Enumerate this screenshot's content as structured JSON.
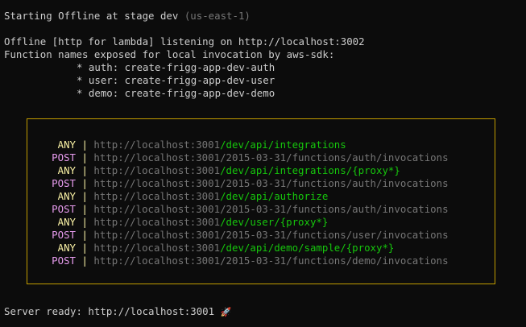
{
  "header": {
    "starting_text": "Starting Offline at stage dev",
    "region_text": "(us-east-1)"
  },
  "info": {
    "listening_line": "Offline [http for lambda] listening on http://localhost:3002",
    "functions_line": "Function names exposed for local invocation by aws-sdk:",
    "functions": [
      "* auth: create-frigg-app-dev-auth",
      "* user: create-frigg-app-dev-user",
      "* demo: create-frigg-app-dev-demo"
    ]
  },
  "routes": [
    {
      "method": "ANY",
      "host": "http://localhost:3001",
      "path": "/dev/api/integrations",
      "kind": "http"
    },
    {
      "method": "POST",
      "host": "http://localhost:3001",
      "path": "/2015-03-31/functions/auth/invocations",
      "kind": "invoke"
    },
    {
      "method": "ANY",
      "host": "http://localhost:3001",
      "path": "/dev/api/integrations/{proxy*}",
      "kind": "http"
    },
    {
      "method": "POST",
      "host": "http://localhost:3001",
      "path": "/2015-03-31/functions/auth/invocations",
      "kind": "invoke"
    },
    {
      "method": "ANY",
      "host": "http://localhost:3001",
      "path": "/dev/api/authorize",
      "kind": "http"
    },
    {
      "method": "POST",
      "host": "http://localhost:3001",
      "path": "/2015-03-31/functions/auth/invocations",
      "kind": "invoke"
    },
    {
      "method": "ANY",
      "host": "http://localhost:3001",
      "path": "/dev/user/{proxy*}",
      "kind": "http"
    },
    {
      "method": "POST",
      "host": "http://localhost:3001",
      "path": "/2015-03-31/functions/user/invocations",
      "kind": "invoke"
    },
    {
      "method": "ANY",
      "host": "http://localhost:3001",
      "path": "/dev/api/demo/sample/{proxy*}",
      "kind": "http"
    },
    {
      "method": "POST",
      "host": "http://localhost:3001",
      "path": "/2015-03-31/functions/demo/invocations",
      "kind": "invoke"
    }
  ],
  "separator": "|",
  "footer": {
    "ready_text": "Server ready: http://localhost:3001",
    "ready_glyph": "🚀"
  },
  "colors": {
    "background": "#0c0c0c",
    "text": "#cccccc",
    "muted": "#767676",
    "any_method": "#f9f1a5",
    "post_method": "#e99df0",
    "path_green": "#16c60c",
    "box_border": "#c19c00"
  }
}
